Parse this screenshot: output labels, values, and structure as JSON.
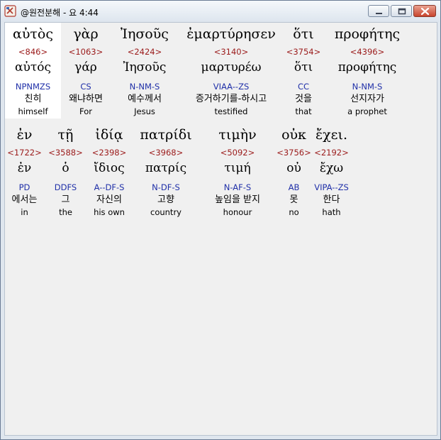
{
  "window": {
    "title": "@원전분해 - 요 4:44",
    "buttons": {
      "minimize": "minimize",
      "maximize": "maximize",
      "close": "close"
    }
  },
  "icons": {
    "app": "bible-book-icon",
    "minimize": "minimize-icon",
    "maximize": "maximize-icon",
    "close": "close-icon"
  },
  "colors": {
    "strong_number": "#9b1b1b",
    "morphology": "#1f2fa8",
    "selected_background": "#ffffff",
    "content_background": "#f0f0f0"
  },
  "verse": {
    "line1": [
      {
        "greek": "αὐτὸς",
        "strong": "<846>",
        "lexeme": "αὐτός",
        "morph": "NPNMZS",
        "korean": "친히",
        "english": "himself",
        "selected": true
      },
      {
        "greek": "γὰρ",
        "strong": "<1063>",
        "lexeme": "γάρ",
        "morph": "CS",
        "korean": "왜냐하면",
        "english": "For"
      },
      {
        "greek": "Ἰησοῦς",
        "strong": "<2424>",
        "lexeme": "Ἰησοῦς",
        "morph": "N-NM-S",
        "korean": "예수께서",
        "english": "Jesus"
      },
      {
        "greek": "ἐμαρτύρησεν",
        "strong": "<3140>",
        "lexeme": "μαρτυρέω",
        "morph": "VIAA--ZS",
        "korean": "증거하기를-하시고",
        "english": "testified"
      },
      {
        "greek": "ὅτι",
        "strong": "<3754>",
        "lexeme": "ὅτι",
        "morph": "CC",
        "korean": "것을",
        "english": "that"
      },
      {
        "greek": "προφήτης",
        "strong": "<4396>",
        "lexeme": "προφήτης",
        "morph": "N-NM-S",
        "korean": "선지자가",
        "english": "a prophet"
      }
    ],
    "line2": [
      {
        "greek": "ἐν",
        "strong": "<1722>",
        "lexeme": "ἐν",
        "morph": "PD",
        "korean": "에서는",
        "english": "in"
      },
      {
        "greek": "τῇ",
        "strong": "<3588>",
        "lexeme": "ὁ",
        "morph": "DDFS",
        "korean": "그",
        "english": "the"
      },
      {
        "greek": "ἰδίᾳ",
        "strong": "<2398>",
        "lexeme": "ἴδιος",
        "morph": "A--DF-S",
        "korean": "자신의",
        "english": "his own"
      },
      {
        "greek": "πατρίδι",
        "strong": "<3968>",
        "lexeme": "πατρίς",
        "morph": "N-DF-S",
        "korean": "고향",
        "english": "country"
      },
      {
        "greek": "τιμὴν",
        "strong": "<5092>",
        "lexeme": "τιμή",
        "morph": "N-AF-S",
        "korean": "높임을 받지",
        "english": "honour"
      },
      {
        "greek": "οὐκ",
        "strong": "<3756>",
        "lexeme": "οὐ",
        "morph": "AB",
        "korean": "못",
        "english": "no"
      },
      {
        "greek": "ἔχει.",
        "strong": "<2192>",
        "lexeme": "ἔχω",
        "morph": "VIPA--ZS",
        "korean": "한다",
        "english": "hath"
      }
    ]
  }
}
